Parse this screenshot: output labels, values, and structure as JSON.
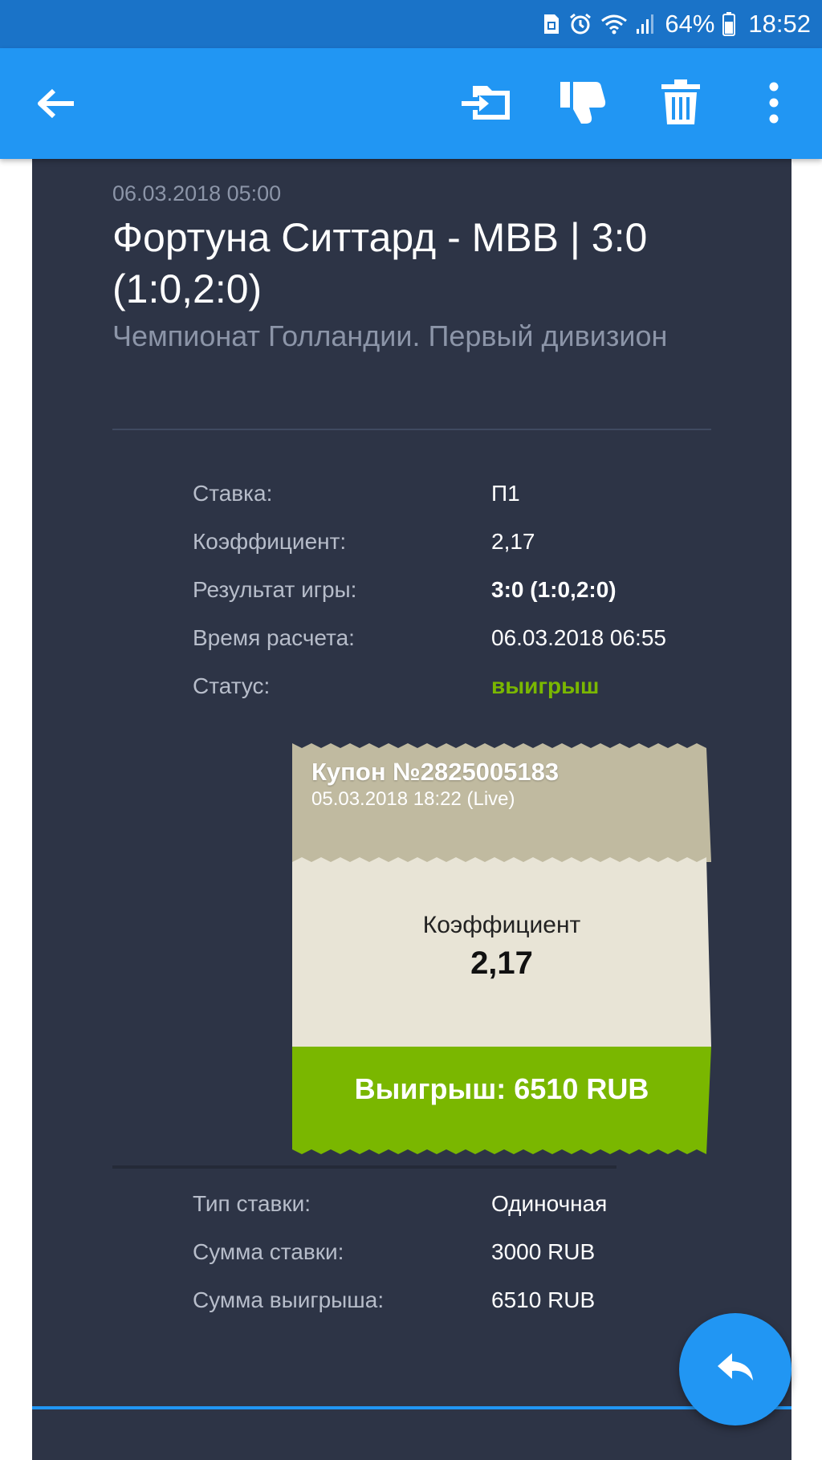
{
  "status_bar": {
    "battery_percent": "64%",
    "time": "18:52",
    "icons": [
      "sim-icon",
      "alarm-icon",
      "wifi-icon",
      "signal-icon",
      "battery-icon"
    ]
  },
  "app_bar": {
    "icons": [
      "back-arrow-icon",
      "export-icon",
      "thumbs-down-icon",
      "trash-icon",
      "more-vert-icon"
    ]
  },
  "event": {
    "date": "06.03.2018 05:00",
    "title": "Фортуна Ситтард - МВВ | 3:0 (1:0,2:0)",
    "league": "Чемпионат Голландии. Первый дивизион"
  },
  "bet_details": [
    {
      "label": "Ставка:",
      "value": "П1",
      "style": "normal"
    },
    {
      "label": "Коэффициент:",
      "value": "2,17",
      "style": "normal"
    },
    {
      "label": "Результат игры:",
      "value": "3:0 (1:0,2:0)",
      "style": "bold"
    },
    {
      "label": "Время расчета:",
      "value": "06.03.2018 06:55",
      "style": "normal"
    },
    {
      "label": "Статус:",
      "value": "выигрыш",
      "style": "win"
    }
  ],
  "coupon": {
    "number": "Купон №2825005183",
    "date": "05.03.2018 18:22 (Live)",
    "coefficient_label": "Коэффициент",
    "coefficient_value": "2,17",
    "win_label": "Выигрыш: 6510 RUB"
  },
  "summary": [
    {
      "label": "Тип ставки:",
      "value": "Одиночная"
    },
    {
      "label": "Сумма ставки:",
      "value": "3000 RUB"
    },
    {
      "label": "Сумма выигрыша:",
      "value": "6510 RUB"
    }
  ],
  "colors": {
    "status_bar": "#1a73c8",
    "app_bar": "#2196f3",
    "card_bg": "#2d3446",
    "win_green": "#7ab700",
    "coupon_header": "#c0baa0",
    "coupon_body": "#e8e4d6"
  },
  "fab": {
    "icon": "reply-icon"
  }
}
